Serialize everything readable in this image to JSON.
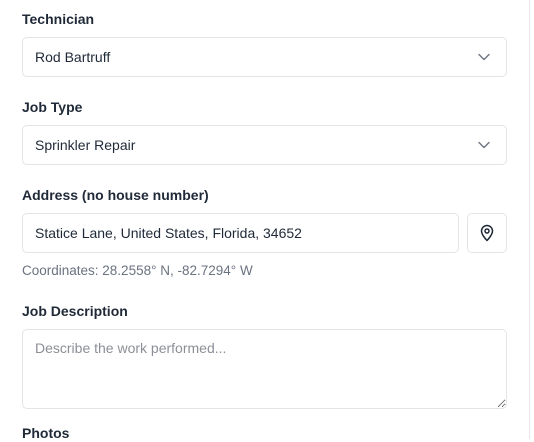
{
  "technician": {
    "label": "Technician",
    "selected": "Rod Bartruff",
    "icon": "chevron-down-icon"
  },
  "job_type": {
    "label": "Job Type",
    "selected": "Sprinkler Repair",
    "icon": "chevron-down-icon"
  },
  "address": {
    "label": "Address (no house number)",
    "value": "Statice Lane, United States, Florida, 34652",
    "locate_icon": "map-pin-icon",
    "coordinates": "Coordinates: 28.2558° N, -82.7294° W"
  },
  "job_description": {
    "label": "Job Description",
    "placeholder": "Describe the work performed..."
  },
  "photos": {
    "label": "Photos"
  },
  "colors": {
    "border": "#e2e4e8",
    "label_text": "#1f2937",
    "muted_text": "#6b7280",
    "placeholder": "#8b8f96"
  }
}
